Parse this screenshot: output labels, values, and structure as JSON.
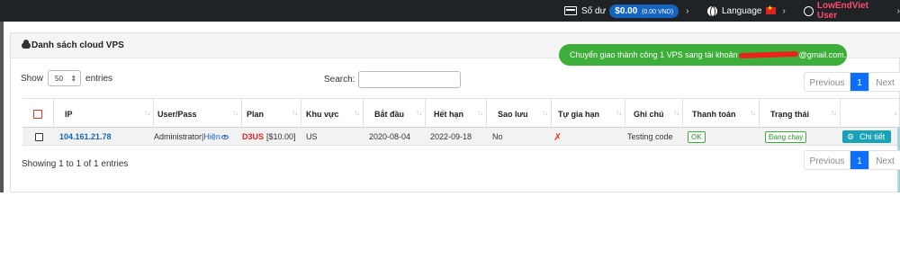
{
  "topbar": {
    "balance_label": "Số dư",
    "balance_value": "$0.00",
    "balance_vnd": "(0.00 VND)",
    "language_label": "Language",
    "user_name": "LowEndViet User"
  },
  "card": {
    "title": "Danh sách cloud VPS"
  },
  "toast": {
    "message_prefix": "Chuyển giao thành công 1 VPS sang tài khoản",
    "message_suffix": "@gmail.com."
  },
  "controls": {
    "show_label": "Show",
    "entries_value": "50",
    "entries_label": "entries",
    "search_label": "Search:"
  },
  "pagination": {
    "previous": "Previous",
    "current": "1",
    "next": "Next"
  },
  "table": {
    "headers": [
      "IP",
      "User/Pass",
      "Plan",
      "Khu vực",
      "Bắt đầu",
      "Hết hạn",
      "Sao lưu",
      "Tự gia hạn",
      "Ghi chú",
      "Thanh toán",
      "Trạng thái"
    ],
    "rows": [
      {
        "ip": "104.161.21.78",
        "user": "Administrator",
        "separator": "|",
        "show_pass": "Hiện",
        "plan_name": "D3US",
        "plan_price": "[$10.00]",
        "region": "US",
        "start": "2020-08-04",
        "expire": "2022-09-18",
        "backup": "No",
        "auto_renew": "✗",
        "note": "Testing code",
        "payment": "OK",
        "status": "Đang chạy",
        "action": "Chi tiết"
      }
    ]
  },
  "info": "Showing 1 to 1 of 1 entries",
  "colors": {
    "accent": "#1565c0",
    "success": "#3eae3a",
    "danger": "#e0242a",
    "info": "#17a2b8"
  }
}
